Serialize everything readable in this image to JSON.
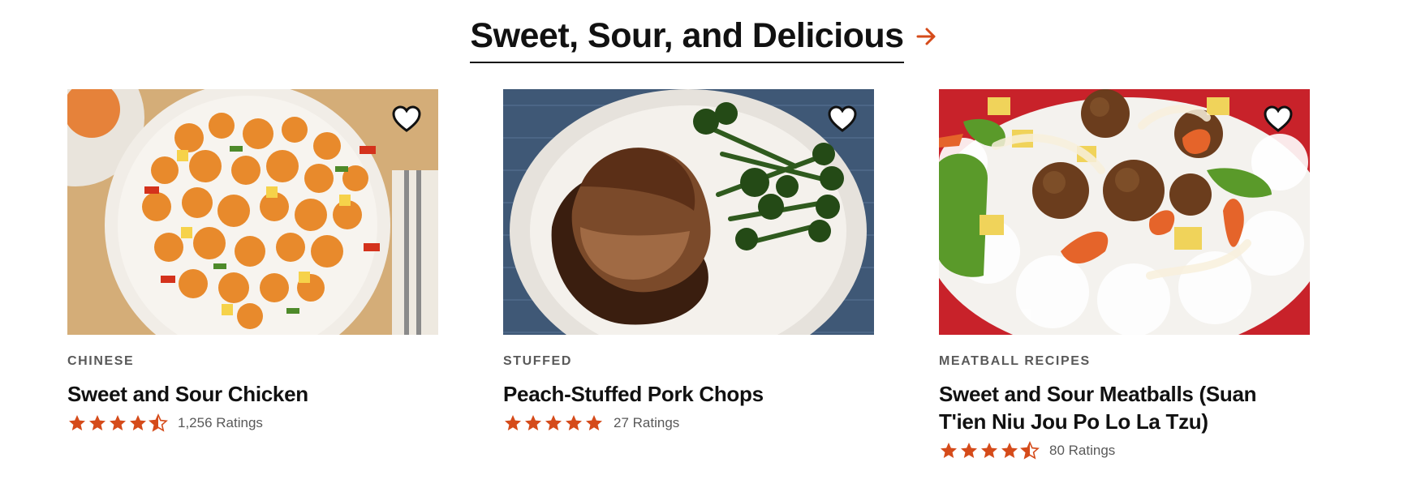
{
  "section": {
    "title": "Sweet, Sour, and Delicious",
    "arrow_icon": "arrow-right-icon",
    "accent_color": "#d54b1a"
  },
  "cards": [
    {
      "tag": "CHINESE",
      "title": "Sweet and Sour Chicken",
      "rating_value": 4.5,
      "ratings_text": "1,256 Ratings",
      "image_alt": "sweet-and-sour-chicken-photo",
      "favorite_icon": "heart-icon"
    },
    {
      "tag": "STUFFED",
      "title": "Peach-Stuffed Pork Chops",
      "rating_value": 5,
      "ratings_text": "27 Ratings",
      "image_alt": "peach-stuffed-pork-chops-photo",
      "favorite_icon": "heart-icon"
    },
    {
      "tag": "MEATBALL RECIPES",
      "title": "Sweet and Sour Meatballs (Suan T'ien Niu Jou Po Lo La Tzu)",
      "rating_value": 4.5,
      "ratings_text": "80 Ratings",
      "image_alt": "sweet-and-sour-meatballs-photo",
      "favorite_icon": "heart-icon"
    }
  ]
}
